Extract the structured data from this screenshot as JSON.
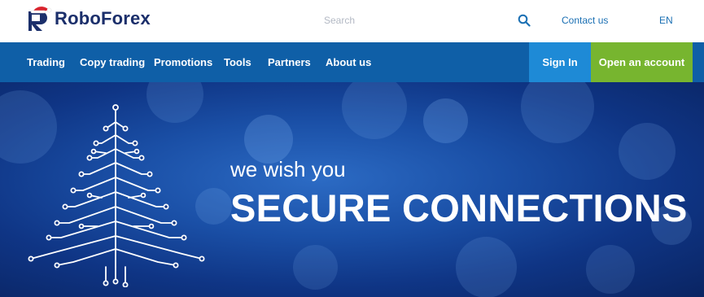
{
  "header": {
    "brand": "RoboForex",
    "search_placeholder": "Search",
    "contact_label": "Contact us",
    "language": "EN"
  },
  "nav": {
    "items": [
      {
        "label": "Trading"
      },
      {
        "label": "Copy trading"
      },
      {
        "label": "Promotions"
      },
      {
        "label": "Tools"
      },
      {
        "label": "Partners"
      },
      {
        "label": "About us"
      }
    ],
    "sign_in_label": "Sign In",
    "open_account_label": "Open an account"
  },
  "hero": {
    "subtitle": "we wish you",
    "title": "SECURE CONNECTIONS"
  },
  "colors": {
    "brand_navy": "#1b2f6b",
    "nav_blue": "#0f5fa7",
    "sign_in_blue": "#1e8ad6",
    "cta_green": "#77b52f",
    "santa_red": "#d9232d"
  },
  "icons": {
    "logo": "roboforex-logo-icon",
    "search": "search-icon",
    "tree": "circuit-tree-icon"
  }
}
